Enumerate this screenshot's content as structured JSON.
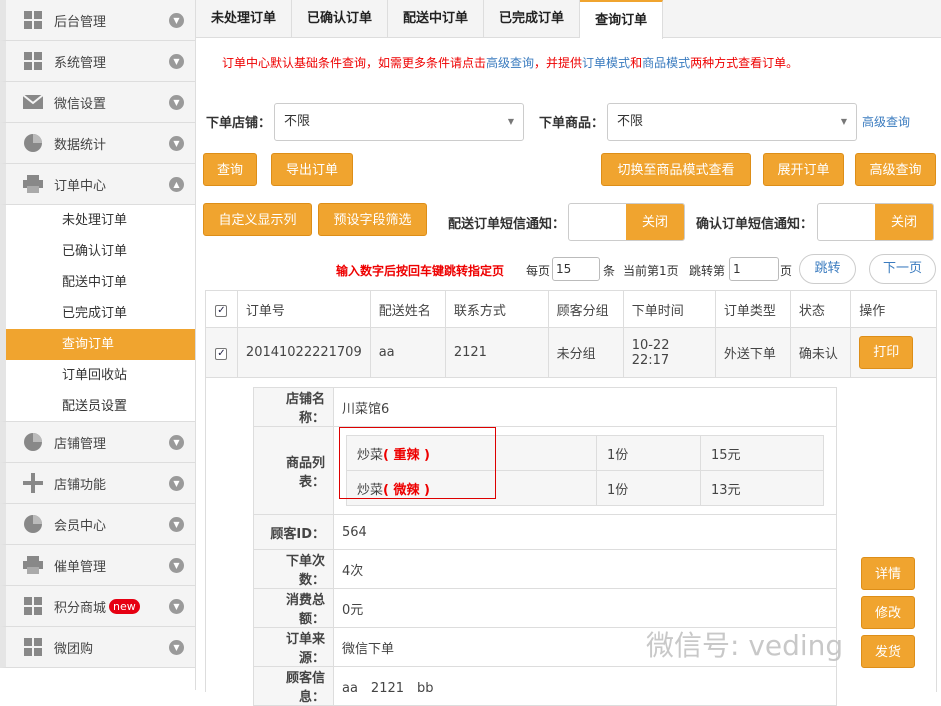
{
  "sidebar": {
    "menu1": {
      "label": "后台管理",
      "icon": "grid-icon"
    },
    "menu2": {
      "label": "系统管理",
      "icon": "grid-icon"
    },
    "menu3": {
      "label": "微信设置",
      "icon": "mail-icon"
    },
    "menu4": {
      "label": "数据统计",
      "icon": "pie-icon"
    },
    "menu5": {
      "label": "订单中心",
      "icon": "printer-icon"
    },
    "sub": [
      "未处理订单",
      "已确认订单",
      "配送中订单",
      "已完成订单",
      "查询订单",
      "订单回收站",
      "配送员设置"
    ],
    "menu6": {
      "label": "店铺管理",
      "icon": "pie-icon"
    },
    "menu7": {
      "label": "店铺功能",
      "icon": "plus-icon"
    },
    "menu8": {
      "label": "会员中心",
      "icon": "pie-icon"
    },
    "menu9": {
      "label": "催单管理",
      "icon": "printer-icon"
    },
    "menu10": {
      "label": "积分商城",
      "icon": "grid-icon",
      "badge": "new"
    },
    "menu11": {
      "label": "微团购",
      "icon": "grid-icon"
    }
  },
  "tabs": [
    "未处理订单",
    "已确认订单",
    "配送中订单",
    "已完成订单",
    "查询订单"
  ],
  "notice": {
    "p1": "订单中心默认基础条件查询，如需更多条件请点击",
    "link1": "高级查询",
    "p2": "，并提供",
    "link2": "订单模式",
    "p3": "和",
    "link3": "商品模式",
    "p4": "两种方式查看订单。"
  },
  "filters": {
    "store_label": "下单店铺：",
    "store_value": "不限",
    "goods_label": "下单商品：",
    "goods_value": "不限",
    "advanced": "高级查询"
  },
  "buttons": {
    "query": "查询",
    "export": "导出订单",
    "switch_mode": "切换至商品模式查看",
    "expand": "展开订单",
    "advanced": "高级查询",
    "custom_cols": "自定义显示列",
    "preset_filter": "预设字段筛选"
  },
  "notify": {
    "delivery_label": "配送订单短信通知：",
    "delivery_state": "关闭",
    "confirm_label": "确认订单短信通知：",
    "confirm_state": "关闭"
  },
  "paging": {
    "hint": "输入数字后按回车键跳转指定页",
    "per_page": "每页",
    "per_value": "15",
    "unit": "条",
    "current": "当前第1页",
    "jump_label": "跳转第",
    "jump_value": "1",
    "page": "页",
    "go": "跳转",
    "next": "下一页"
  },
  "table": {
    "headers": [
      "订单号",
      "配送姓名",
      "联系方式",
      "顾客分组",
      "下单时间",
      "订单类型",
      "状态",
      "操作"
    ],
    "row": {
      "order_no": "20141022221709",
      "name": "aa",
      "contact": "2121",
      "group": "未分组",
      "time": "10-22 22:17",
      "type": "外送下单",
      "status": "确未认",
      "action": "打印"
    }
  },
  "detail": {
    "store_key": "店铺名称：",
    "store_val": "川菜馆6",
    "goods_key": "商品列表：",
    "goods": [
      {
        "name": "炒菜",
        "spicy": "( 重辣 )",
        "qty": "1份",
        "price": "15元"
      },
      {
        "name": "炒菜",
        "spicy": "( 微辣 )",
        "qty": "1份",
        "price": "13元"
      }
    ],
    "cust_id_key": "顾客ID：",
    "cust_id_val": "564",
    "orders_key": "下单次数：",
    "orders_val": "4次",
    "total_key": "消费总额：",
    "total_val": "0元",
    "source_key": "订单来源：",
    "source_val": "微信下单",
    "info_key": "顾客信息：",
    "info_val": "aa　2121　bb"
  },
  "side_actions": {
    "detail": "详情",
    "modify": "修改",
    "send": "发货"
  },
  "watermark": "微信号: veding"
}
